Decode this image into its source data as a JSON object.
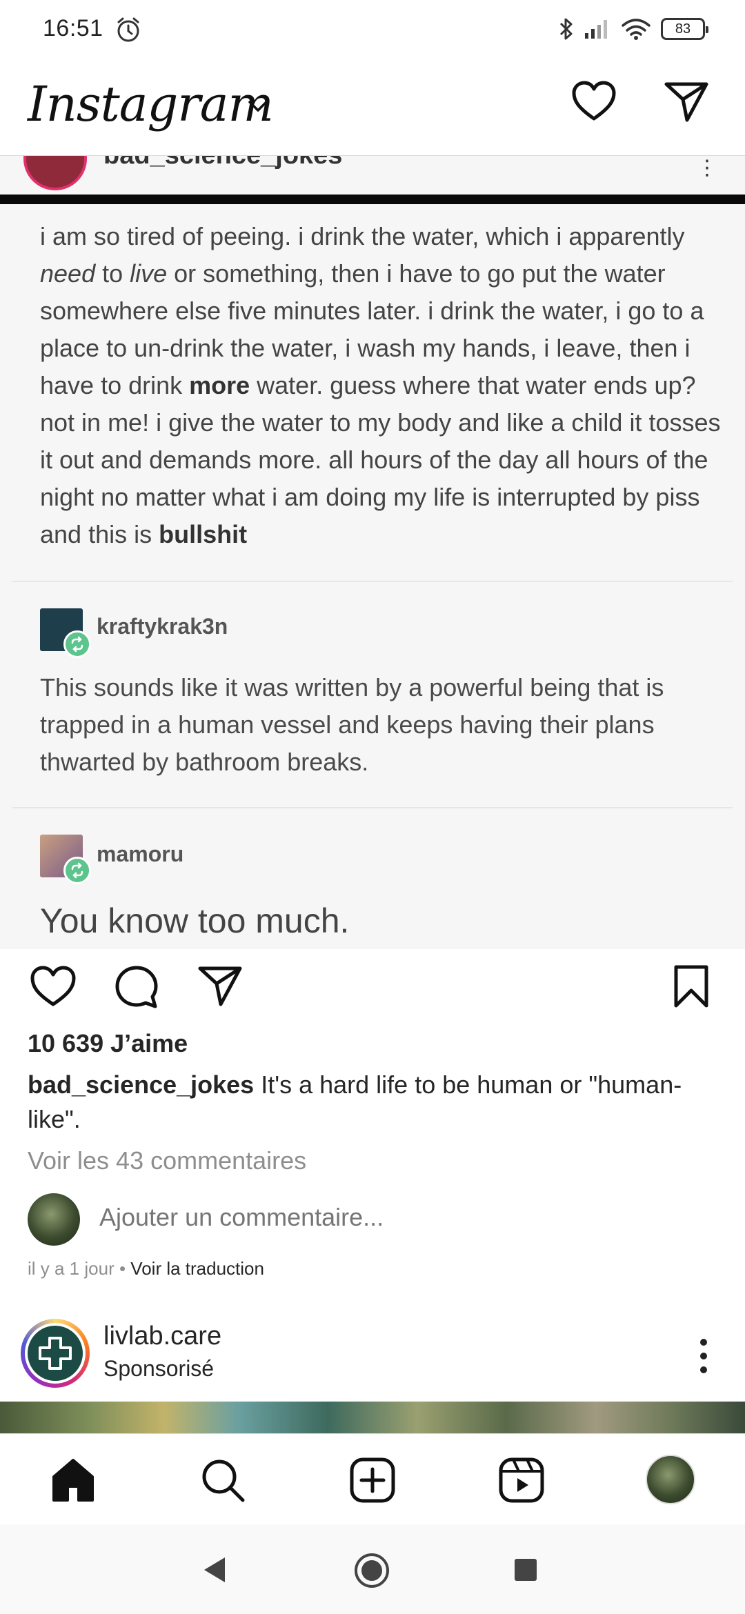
{
  "status_bar": {
    "time": "16:51",
    "battery": "83",
    "icons": [
      "alarm-icon",
      "bluetooth-icon",
      "signal-icon",
      "wifi-icon",
      "battery-icon"
    ]
  },
  "header": {
    "logo": "Instagram",
    "icons": [
      "chevron-down-icon",
      "heart-icon",
      "send-icon"
    ]
  },
  "post": {
    "peek_username": "bad_science_jokes",
    "original_text_html": "i am so tired of peeing. i drink the water, which i apparently <i>need</i> to <i>live</i> or something, then i have to go put the water somewhere else five minutes later. i drink the water, i go to a place to un-drink the water, i wash my hands, i leave, then i have to drink <b>more</b> water. guess where that water ends up? not in me! i give the water to my body and like a child it tosses it out and demands more. all hours of the day all hours of the night no matter what i am doing my life is interrupted by piss and this is <b>bullshit</b>",
    "reblogs": [
      {
        "username": "kraftykrak3n",
        "text": "This sounds like it was written by a powerful being that is trapped in a human vessel and keeps having their plans thwarted by bathroom breaks."
      },
      {
        "username": "mamoru",
        "text": "You know too much."
      }
    ],
    "likes": "10 639 J’aime",
    "caption_user": "bad_science_jokes",
    "caption_text": "It's a hard life to be human or \"human-like\".",
    "view_comments": "Voir les 43 commentaires",
    "comment_placeholder": "Ajouter un commentaire...",
    "time_ago": "il y a 1 jour",
    "separator": " • ",
    "translate": "Voir la traduction"
  },
  "next_post": {
    "username": "livlab.care",
    "sponsored": "Sponsorisé"
  },
  "bottom_nav": {
    "items": [
      "home-icon",
      "search-icon",
      "create-icon",
      "reels-icon",
      "profile-avatar"
    ]
  },
  "system_nav": {
    "items": [
      "back-icon",
      "home-circle-icon",
      "recents-icon"
    ]
  },
  "colors": {
    "text": "#262626",
    "muted": "#8e8e8e",
    "reblog_badge": "#5cc48c",
    "sponsor_brand": "#1c4a44"
  }
}
